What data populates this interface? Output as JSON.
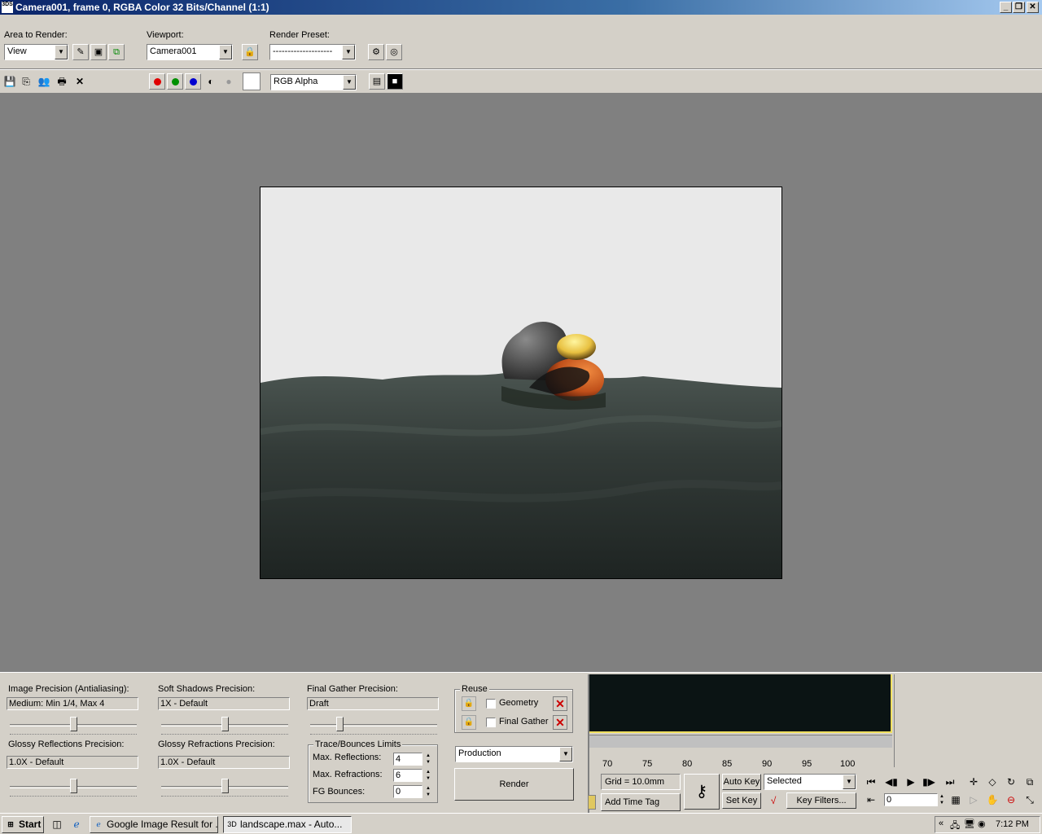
{
  "window": {
    "title": "Camera001, frame 0, RGBA Color 32 Bits/Channel (1:1)",
    "app_icon_text": "3DS"
  },
  "toolbar": {
    "area_to_render_label": "Area to Render:",
    "area_to_render_value": "View",
    "viewport_label": "Viewport:",
    "viewport_value": "Camera001",
    "render_preset_label": "Render Preset:",
    "render_preset_value": "--------------------",
    "channel_value": "RGB Alpha"
  },
  "panel": {
    "image_precision_label": "Image Precision (Antialiasing):",
    "image_precision_value": "Medium: Min 1/4, Max 4",
    "image_precision_level": 0.5,
    "soft_shadows_label": "Soft Shadows Precision:",
    "soft_shadows_value": "1X - Default",
    "soft_shadows_level": 0.5,
    "final_gather_label": "Final Gather Precision:",
    "final_gather_value": "Draft",
    "final_gather_level": 0.22,
    "glossy_reflections_label": "Glossy Reflections Precision:",
    "glossy_reflections_value": "1.0X - Default",
    "glossy_reflections_level": 0.5,
    "glossy_refractions_label": "Glossy Refractions Precision:",
    "glossy_refractions_value": "1.0X - Default",
    "glossy_refractions_level": 0.5,
    "reuse_title": "Reuse",
    "reuse_geometry_label": "Geometry",
    "reuse_final_gather_label": "Final Gather",
    "trace_title": "Trace/Bounces Limits",
    "max_reflections_label": "Max. Reflections:",
    "max_reflections_value": "4",
    "max_refractions_label": "Max. Refractions:",
    "max_refractions_value": "6",
    "fg_bounces_label": "FG Bounces:",
    "fg_bounces_value": "0",
    "preset_value": "Production",
    "render_button": "Render"
  },
  "timeline": {
    "ticks": [
      "70",
      "75",
      "80",
      "85",
      "90",
      "95",
      "100"
    ]
  },
  "status": {
    "grid": "Grid = 10.0mm",
    "add_time_tag": "Add Time Tag",
    "auto_key": "Auto Key",
    "set_key": "Set Key",
    "selected": "Selected",
    "key_filters": "Key Filters...",
    "frame_value": "0"
  },
  "taskbar": {
    "start": "Start",
    "task1": "Google Image Result for ...",
    "task2": "landscape.max - Auto...",
    "clock": "7:12 PM",
    "chevron": "«"
  }
}
